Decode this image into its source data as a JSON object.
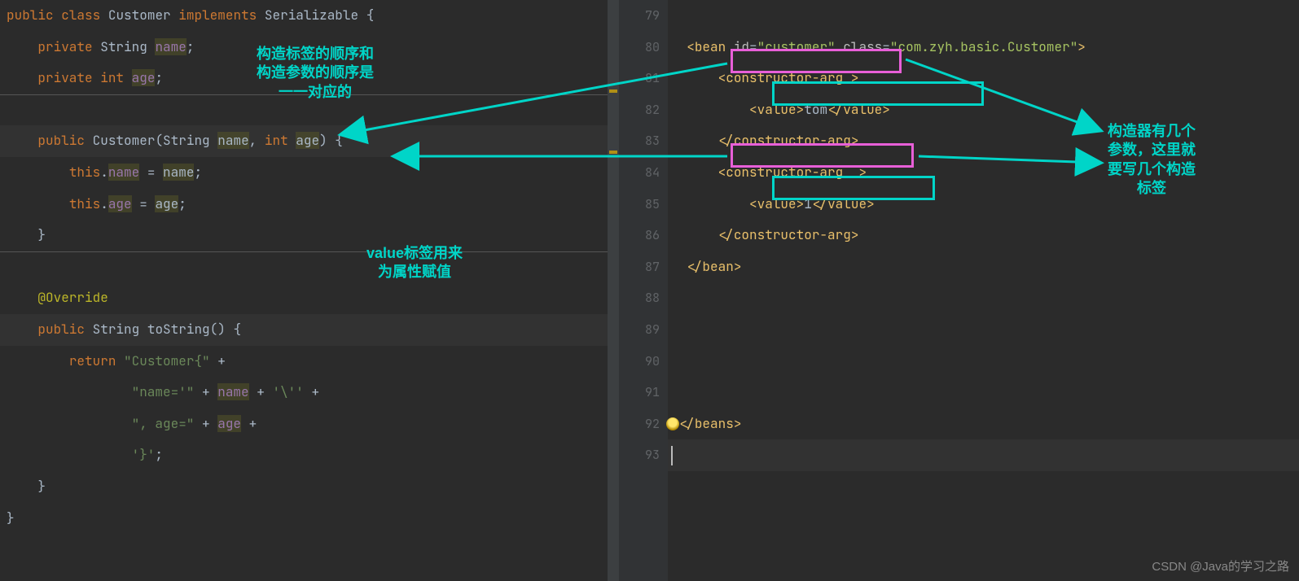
{
  "left_code": {
    "l1": {
      "kw1": "public",
      "kw2": "class",
      "cls": "Customer",
      "kw3": "implements",
      "iface": "Serializable",
      "brace": "{"
    },
    "l2": {
      "kw": "private",
      "type": "String",
      "name": "name",
      "semi": ";"
    },
    "l3": {
      "kw": "private",
      "type": "int",
      "name": "age",
      "semi": ";"
    },
    "l5": {
      "kw": "public",
      "ctor": "Customer",
      "p1t": "String",
      "p1n": "name",
      "p2t": "int",
      "p2n": "age",
      "tail": ") {"
    },
    "l6": {
      "this": "this",
      "dot": ".",
      "f": "name",
      "eq": " = ",
      "v": "name",
      "semi": ";"
    },
    "l7": {
      "this": "this",
      "dot": ".",
      "f": "age",
      "eq": " = ",
      "v": "age",
      "semi": ";"
    },
    "l8": {
      "brace": "}"
    },
    "l10": {
      "ann": "@Override"
    },
    "l11": {
      "kw": "public",
      "type": "String",
      "m": "toString",
      "tail": "() {"
    },
    "l12": {
      "kw": "return",
      "s": "\"Customer{\"",
      "plus": " +"
    },
    "l13": {
      "s": "\"name='\"",
      "plus1": " + ",
      "v": "name",
      "plus2": " + ",
      "s2": "'\\''",
      "plus3": " +"
    },
    "l14": {
      "s": "\", age=\"",
      "plus1": " + ",
      "v": "age",
      "plus2": " +"
    },
    "l15": {
      "s": "'}'",
      "semi": ";"
    },
    "l16": {
      "brace": "}"
    },
    "l17": {
      "brace": "}"
    }
  },
  "right_lines": [
    "79",
    "80",
    "81",
    "82",
    "83",
    "84",
    "85",
    "86",
    "87",
    "88",
    "89",
    "90",
    "91",
    "92",
    "93"
  ],
  "right_code": {
    "l80": {
      "open": "<",
      "tag": "bean",
      "a1": "id",
      "v1": "\"customer\"",
      "a2": "class",
      "v2": "\"com.zyh.basic.Customer\"",
      "close": ">"
    },
    "l81": {
      "open": "<",
      "tag": "constructor-arg",
      "sp": " ",
      "close": ">"
    },
    "l82": {
      "open": "<",
      "tag": "value",
      "close1": ">",
      "txt": "tom",
      "open2": "</",
      "tag2": "value",
      "close2": ">"
    },
    "l83": {
      "open": "</",
      "tag": "constructor-arg",
      "close": ">"
    },
    "l84": {
      "open": "<",
      "tag": "constructor-arg",
      "sp": "  ",
      "close": ">"
    },
    "l85": {
      "open": "<",
      "tag": "value",
      "close1": ">",
      "txt": "1",
      "open2": "</",
      "tag2": "value",
      "close2": ">"
    },
    "l86": {
      "open": "</",
      "tag": "constructor-arg",
      "close": ">"
    },
    "l87": {
      "open": "</",
      "tag": "bean",
      "close": ">"
    },
    "l92": {
      "open": "</",
      "tag": "beans",
      "close": ">"
    }
  },
  "annotations": {
    "a1_l1": "构造标签的顺序和",
    "a1_l2": "构造参数的顺序是",
    "a1_l3": "一一对应的",
    "a2_l1": "value标签用来",
    "a2_l2": "为属性赋值",
    "a3_l1": "构造器有几个",
    "a3_l2": "参数，这里就",
    "a3_l3": "要写几个构造",
    "a3_l4": "标签"
  },
  "watermark": "CSDN @Java的学习之路"
}
